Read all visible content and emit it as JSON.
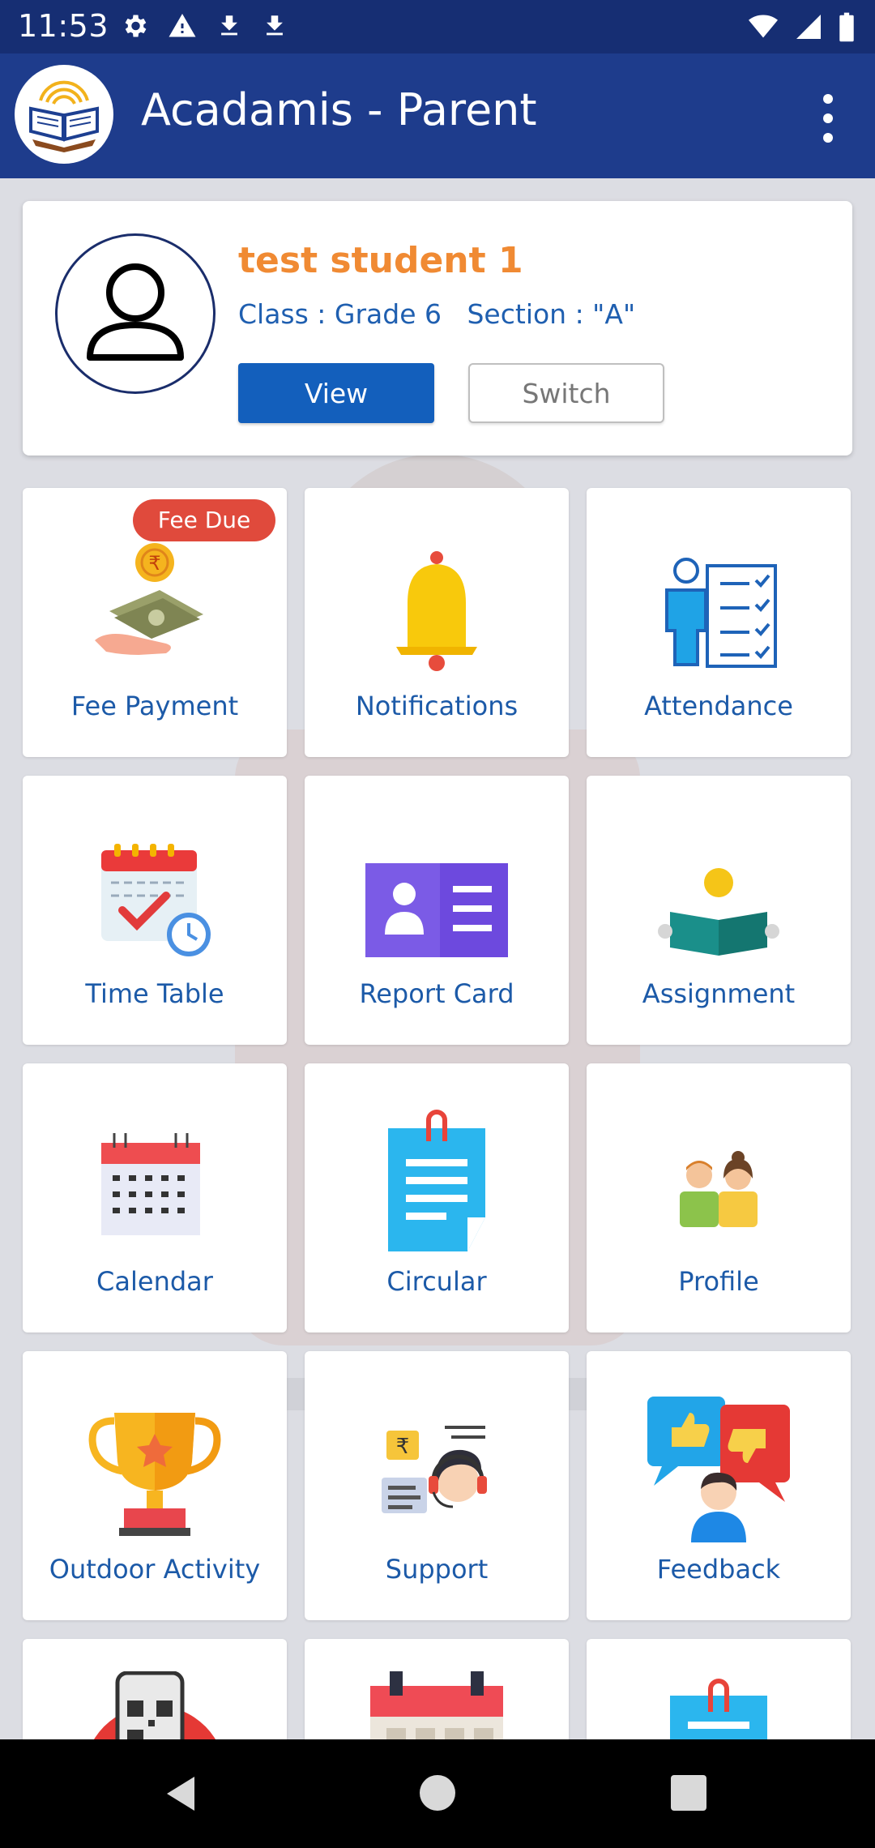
{
  "status_bar": {
    "time": "11:53",
    "left_icons": [
      "gear-icon",
      "warning-icon",
      "download-icon",
      "download-icon"
    ],
    "right_icons": [
      "wifi-icon",
      "signal-icon",
      "battery-icon"
    ]
  },
  "app_bar": {
    "title": "Acadamis - Parent",
    "logo": "school-book-logo",
    "menu_icon": "more-vert-icon"
  },
  "student": {
    "name": "test student 1",
    "class_section": "Class : Grade 6   Section : \"A\"",
    "view_label": "View",
    "switch_label": "Switch"
  },
  "tiles": [
    {
      "label": "Fee Payment",
      "icon": "fee-payment-icon",
      "badge": "Fee Due"
    },
    {
      "label": "Notifications",
      "icon": "bell-icon"
    },
    {
      "label": "Attendance",
      "icon": "attendance-checklist-icon"
    },
    {
      "label": "Time Table",
      "icon": "timetable-calendar-icon"
    },
    {
      "label": "Report Card",
      "icon": "report-card-icon"
    },
    {
      "label": "Assignment",
      "icon": "reading-book-icon"
    },
    {
      "label": "Calendar",
      "icon": "calendar-icon"
    },
    {
      "label": "Circular",
      "icon": "circular-document-icon"
    },
    {
      "label": "Profile",
      "icon": "parents-icon"
    },
    {
      "label": "Outdoor Activity",
      "icon": "trophy-icon"
    },
    {
      "label": "Support",
      "icon": "support-agent-icon"
    },
    {
      "label": "Feedback",
      "icon": "feedback-thumbs-icon"
    },
    {
      "label": "",
      "icon": "qr-code-phone-icon"
    },
    {
      "label": "",
      "icon": "event-calendar-icon"
    },
    {
      "label": "",
      "icon": "clipboard-icon"
    }
  ],
  "colors": {
    "status_bar": "#162e73",
    "app_bar": "#1e3c8c",
    "student_name": "#f08a33",
    "accent_blue": "#135fbc",
    "badge_red": "#e04a3c",
    "tile_label": "#1c5aa8"
  },
  "nav_bar": {
    "icons": [
      "back-icon",
      "home-icon",
      "recents-icon"
    ]
  }
}
